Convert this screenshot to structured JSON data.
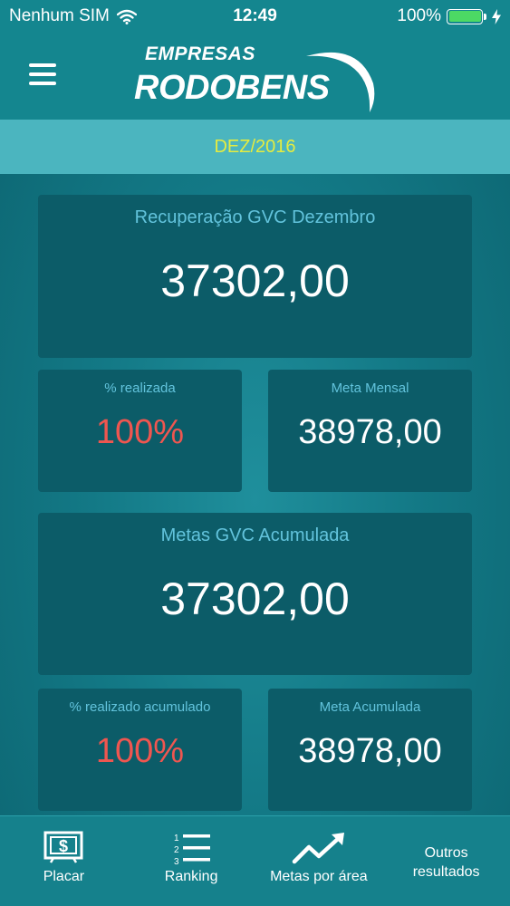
{
  "status_bar": {
    "carrier": "Nenhum SIM",
    "time": "12:49",
    "battery": "100%",
    "battery_level": 1.0,
    "icons": [
      "wifi-icon",
      "battery-icon",
      "charging-bolt-icon"
    ]
  },
  "header": {
    "logo_top": "EMPRESAS",
    "logo_main": "RODOBENS",
    "icons": [
      "hamburger-menu-icon"
    ]
  },
  "period": {
    "label": "DEZ/2016"
  },
  "cards": {
    "recovery": {
      "title": "Recuperação GVC Dezembro",
      "value": "37302,00"
    },
    "pct_done": {
      "title": "% realizada",
      "value": "100%"
    },
    "monthly_goal": {
      "title": "Meta Mensal",
      "value": "38978,00"
    },
    "accumulated": {
      "title": "Metas GVC Acumulada",
      "value": "37302,00"
    },
    "pct_accumulated": {
      "title": "% realizado acumulado",
      "value": "100%"
    },
    "accumulated_goal": {
      "title": "Meta Acumulada",
      "value": "38978,00"
    }
  },
  "tabs": [
    {
      "label": "Placar",
      "icon": "dollar-board-icon"
    },
    {
      "label": "Ranking",
      "icon": "numbered-list-icon"
    },
    {
      "label": "Metas por área",
      "icon": "trend-up-icon"
    },
    {
      "label": "Outros resultados",
      "icon": ""
    }
  ],
  "colors": {
    "header_bg": "#14868f",
    "period_bar_bg": "#4bb5bf",
    "period_text": "#e6ec3f",
    "card_bg": "#0c5c68",
    "card_title": "#62c3dc",
    "percent_value": "#ef5650",
    "battery_green": "#4cd964"
  }
}
